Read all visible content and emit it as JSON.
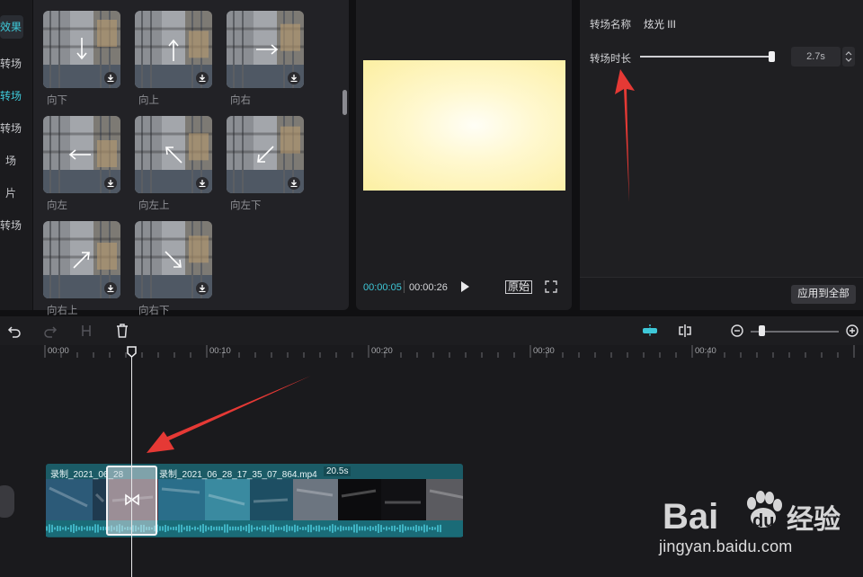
{
  "left_nav": {
    "items": [
      {
        "label": "效果",
        "state": "highlight"
      },
      {
        "label": "转场",
        "state": "normal"
      },
      {
        "label": "转场",
        "state": "active"
      },
      {
        "label": "转场",
        "state": "normal"
      },
      {
        "label": "场",
        "state": "normal"
      },
      {
        "label": "片",
        "state": "normal"
      },
      {
        "label": "转场",
        "state": "normal"
      }
    ]
  },
  "transitions": {
    "items": [
      {
        "label": "向下",
        "icon": "arrow-down-icon"
      },
      {
        "label": "向上",
        "icon": "arrow-up-icon"
      },
      {
        "label": "向右",
        "icon": "arrow-right-icon"
      },
      {
        "label": "向左",
        "icon": "arrow-left-icon"
      },
      {
        "label": "向左上",
        "icon": "arrow-up-left-icon"
      },
      {
        "label": "向左下",
        "icon": "arrow-down-left-icon"
      },
      {
        "label": "向右上",
        "icon": "arrow-up-right-icon"
      },
      {
        "label": "向右下",
        "icon": "arrow-down-right-icon"
      }
    ]
  },
  "player": {
    "current_time": "00:00:05",
    "total_time": "00:00:26",
    "ratio_label": "原始"
  },
  "properties": {
    "name_label": "转场名称",
    "name_value": "炫光 III",
    "duration_label": "转场时长",
    "duration_value": "2.7s",
    "duration_fraction": 0.97,
    "apply_all": "应用到全部"
  },
  "timeline": {
    "ticks": [
      "00:00",
      "00:10",
      "00:20",
      "00:30",
      "00:40"
    ],
    "zoom_fraction": 0.12,
    "clip": {
      "name_left": "录制_2021_06_28",
      "name_right": "录制_2021_06_28_17_35_07_864.mp4",
      "duration": "20.5s"
    }
  },
  "watermark": {
    "text": "jingyan.baidu.com",
    "brand": "Bai du 经验"
  },
  "colors": {
    "accent": "#3ec8d8",
    "annotation_arrow": "#e53935",
    "clip": "#1b5b66"
  }
}
